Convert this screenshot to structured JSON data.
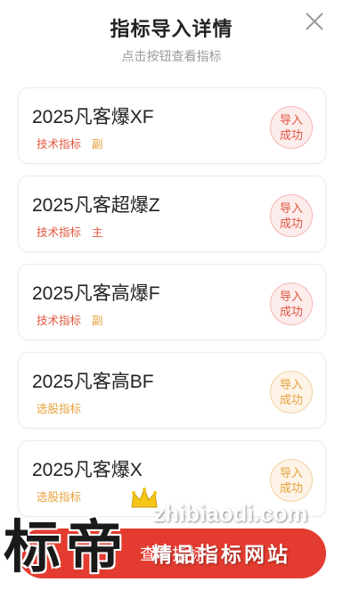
{
  "header": {
    "title": "指标导入详情",
    "subtitle": "点击按钮查看指标"
  },
  "items": [
    {
      "name": "2025凡客爆XF",
      "tags": [
        {
          "text": "技术指标",
          "color": "red"
        },
        {
          "text": "副",
          "color": "orange"
        }
      ],
      "status": "导入成功",
      "status_color": "red"
    },
    {
      "name": "2025凡客超爆Z",
      "tags": [
        {
          "text": "技术指标",
          "color": "red"
        },
        {
          "text": "主",
          "color": "red"
        }
      ],
      "status": "导入成功",
      "status_color": "red"
    },
    {
      "name": "2025凡客高爆F",
      "tags": [
        {
          "text": "技术指标",
          "color": "red"
        },
        {
          "text": "副",
          "color": "orange"
        }
      ],
      "status": "导入成功",
      "status_color": "red"
    },
    {
      "name": "2025凡客高BF",
      "tags": [
        {
          "text": "选股指标",
          "color": "orange"
        }
      ],
      "status": "导入成功",
      "status_color": "orange"
    },
    {
      "name": "2025凡客爆X",
      "tags": [
        {
          "text": "选股指标",
          "color": "orange"
        }
      ],
      "status": "导入成功",
      "status_color": "orange"
    }
  ],
  "bottom_button": {
    "label": "查看指标"
  },
  "watermark": {
    "big_text": "标帝",
    "site": "zhibiaodi.com",
    "tagline": "精品指标网站"
  },
  "colors": {
    "accent_red": "#e33b2f",
    "tag_red": "#e0573f",
    "tag_orange": "#e6a23c"
  }
}
